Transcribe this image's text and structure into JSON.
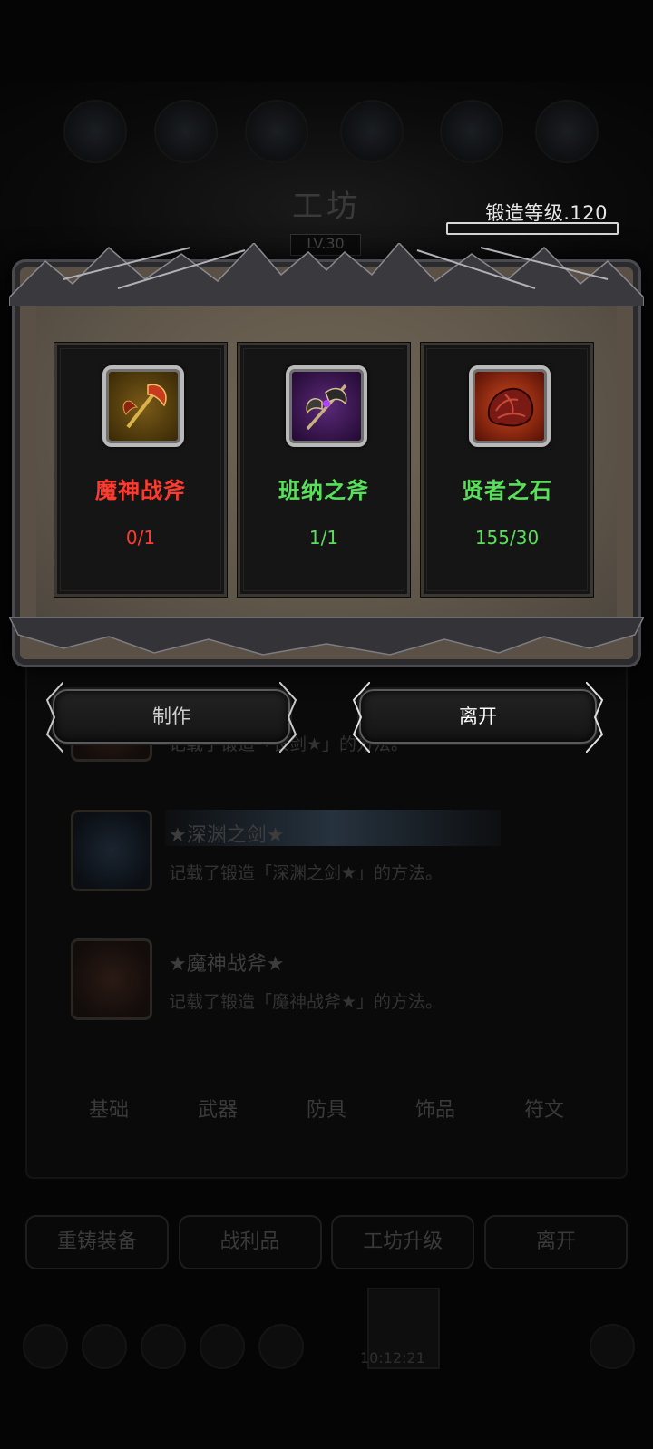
{
  "background": {
    "title": "工坊",
    "level_badge": "LV.30",
    "list_items": [
      {
        "title": "",
        "desc": "记载了锻造「长剑★」的方法。"
      },
      {
        "title": "★深渊之剑★",
        "desc": "记载了锻造「深渊之剑★」的方法。"
      },
      {
        "title": "★魔神战斧★",
        "desc": "记载了锻造「魔神战斧★」的方法。"
      }
    ],
    "tabs": [
      "基础",
      "武器",
      "防具",
      "饰品",
      "符文"
    ],
    "actions": [
      "重铸装备",
      "战利品",
      "工坊升级",
      "离开"
    ],
    "clock": "10:12:21"
  },
  "forge": {
    "level_text": "锻造等级.120",
    "progress": 0
  },
  "materials": [
    {
      "name": "魔神战斧",
      "count": "0/1",
      "color": "#ff3b2f",
      "icon": "axe-icon",
      "icon_bg": "#5a3e0a"
    },
    {
      "name": "班纳之斧",
      "count": "1/1",
      "color": "#58e05a",
      "icon": "halberd-icon",
      "icon_bg": "#3a1650"
    },
    {
      "name": "贤者之石",
      "count": "155/30",
      "color": "#58e05a",
      "icon": "stone-icon",
      "icon_bg": "#6a1a0c"
    }
  ],
  "buttons": {
    "craft": "制作",
    "leave": "离开"
  },
  "colors": {
    "craft_text": "#cfcfcf",
    "leave_text": "#ffffff"
  }
}
